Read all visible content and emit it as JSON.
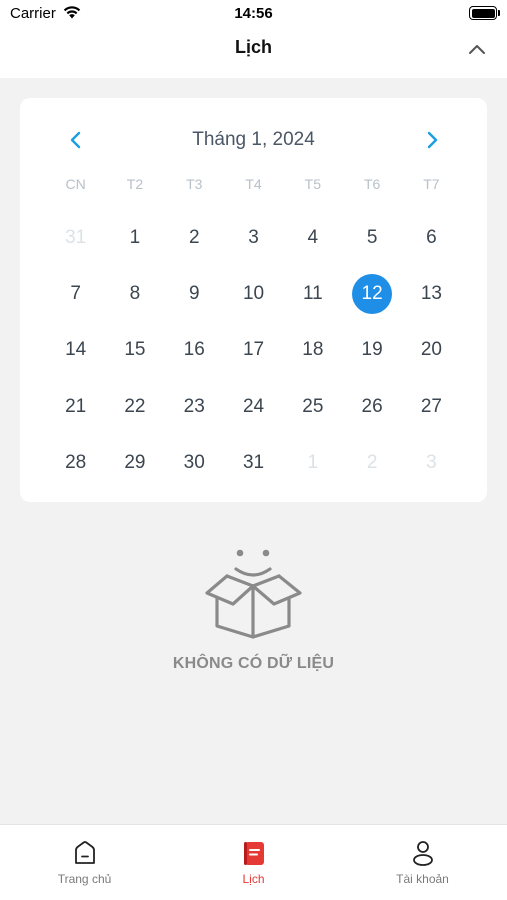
{
  "status_bar": {
    "carrier": "Carrier",
    "time": "14:56"
  },
  "header": {
    "title": "Lịch"
  },
  "calendar": {
    "month_label": "Tháng 1, 2024",
    "weekdays": [
      "CN",
      "T2",
      "T3",
      "T4",
      "T5",
      "T6",
      "T7"
    ],
    "days": [
      {
        "label": "31",
        "muted": true
      },
      {
        "label": "1"
      },
      {
        "label": "2"
      },
      {
        "label": "3"
      },
      {
        "label": "4"
      },
      {
        "label": "5"
      },
      {
        "label": "6"
      },
      {
        "label": "7"
      },
      {
        "label": "8"
      },
      {
        "label": "9"
      },
      {
        "label": "10"
      },
      {
        "label": "11"
      },
      {
        "label": "12",
        "selected": true
      },
      {
        "label": "13"
      },
      {
        "label": "14"
      },
      {
        "label": "15"
      },
      {
        "label": "16"
      },
      {
        "label": "17"
      },
      {
        "label": "18"
      },
      {
        "label": "19"
      },
      {
        "label": "20"
      },
      {
        "label": "21"
      },
      {
        "label": "22"
      },
      {
        "label": "23"
      },
      {
        "label": "24"
      },
      {
        "label": "25"
      },
      {
        "label": "26"
      },
      {
        "label": "27"
      },
      {
        "label": "28"
      },
      {
        "label": "29"
      },
      {
        "label": "30"
      },
      {
        "label": "31"
      },
      {
        "label": "1",
        "muted": true
      },
      {
        "label": "2",
        "muted": true
      },
      {
        "label": "3",
        "muted": true
      }
    ],
    "selected_color": "#1f8ee6",
    "arrow_color": "#1aa0e0"
  },
  "empty_state": {
    "text": "KHÔNG CÓ DỮ LIỆU",
    "icon": "empty-box-icon"
  },
  "tab_bar": {
    "active_color": "#e53935",
    "tabs": [
      {
        "label": "Trang chủ",
        "icon": "home-icon"
      },
      {
        "label": "Lịch",
        "icon": "calendar-icon",
        "active": true
      },
      {
        "label": "Tài khoản",
        "icon": "user-icon"
      }
    ]
  }
}
